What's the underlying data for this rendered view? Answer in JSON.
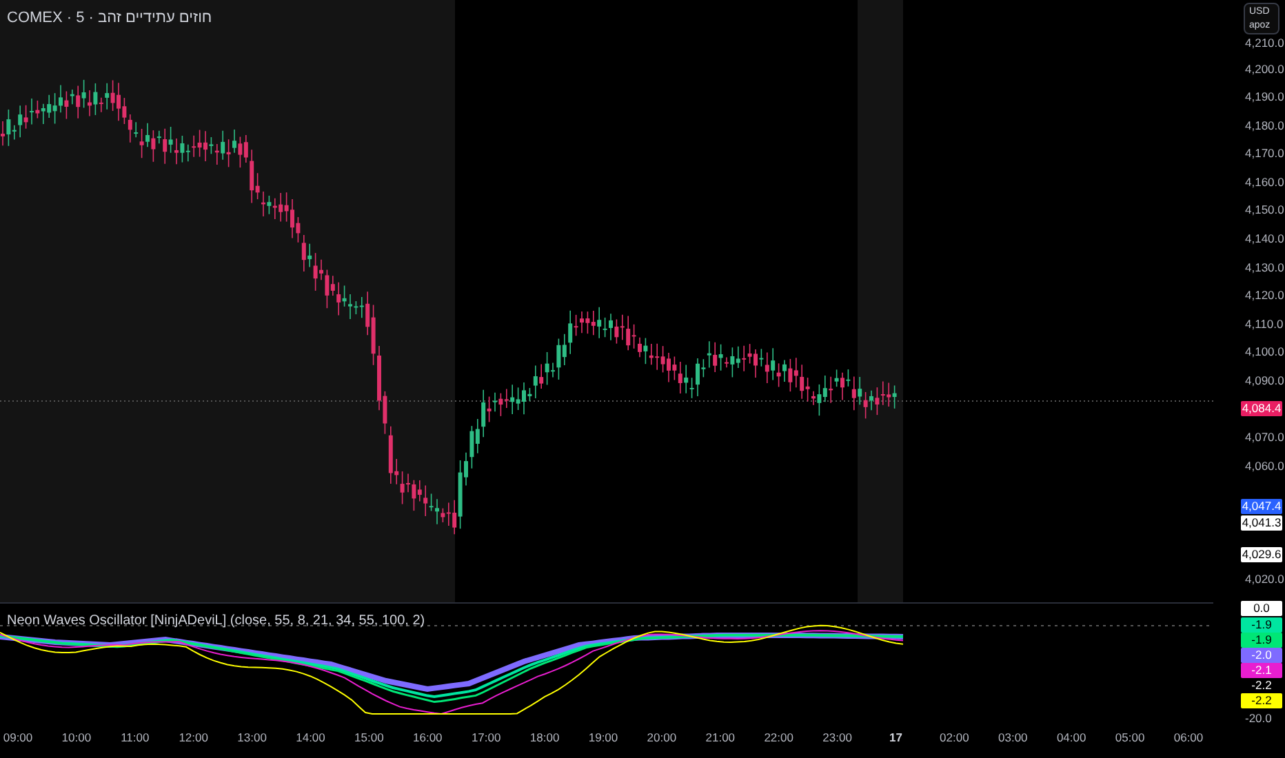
{
  "chart_title": "COMEX · 5 · חוזים עתידיים זהב",
  "currency_box": {
    "currency": "USD",
    "unit": "apoz"
  },
  "price_axis": {
    "ticks": [
      "4,210.0",
      "4,200.0",
      "4,190.0",
      "4,180.0",
      "4,170.0",
      "4,160.0",
      "4,150.0",
      "4,140.0",
      "4,130.0",
      "4,120.0",
      "4,110.0",
      "4,100.0",
      "4,090.0",
      "4,070.0",
      "4,060.0",
      "4,020.0"
    ],
    "badges": [
      {
        "text": "4,084.4",
        "color": "#e91e63"
      },
      {
        "text": "4,047.4",
        "color": "#2962ff"
      },
      {
        "text": "4,041.3",
        "color": "#ffffff"
      },
      {
        "text": "4,029.6",
        "color": "#ffffff"
      }
    ]
  },
  "indicator": {
    "title": "Neon Waves Oscillator [NinjADeviL] (close, 55, 8, 21, 34, 55, 100, 2)",
    "badges": [
      {
        "text": "0.0",
        "color": "#ffffff"
      },
      {
        "text": "-1.9",
        "color": "#00e5a0"
      },
      {
        "text": "-1.9",
        "color": "#00e676"
      },
      {
        "text": "-2.0",
        "color": "#7e6bff"
      },
      {
        "text": "-2.1",
        "color": "#e91ed0"
      },
      {
        "text": "-2.2",
        "color": "#000000"
      },
      {
        "text": "-2.2",
        "color": "#ffff00"
      }
    ],
    "tick": "-20.0"
  },
  "time_axis": [
    {
      "label": "09:00",
      "bold": false
    },
    {
      "label": "10:00",
      "bold": false
    },
    {
      "label": "11:00",
      "bold": false
    },
    {
      "label": "12:00",
      "bold": false
    },
    {
      "label": "13:00",
      "bold": false
    },
    {
      "label": "14:00",
      "bold": false
    },
    {
      "label": "15:00",
      "bold": false
    },
    {
      "label": "16:00",
      "bold": false
    },
    {
      "label": "17:00",
      "bold": false
    },
    {
      "label": "18:00",
      "bold": false
    },
    {
      "label": "19:00",
      "bold": false
    },
    {
      "label": "20:00",
      "bold": false
    },
    {
      "label": "21:00",
      "bold": false
    },
    {
      "label": "22:00",
      "bold": false
    },
    {
      "label": "23:00",
      "bold": false
    },
    {
      "label": "17",
      "bold": true
    },
    {
      "label": "02:00",
      "bold": false
    },
    {
      "label": "03:00",
      "bold": false
    },
    {
      "label": "04:00",
      "bold": false
    },
    {
      "label": "05:00",
      "bold": false
    },
    {
      "label": "06:00",
      "bold": false
    }
  ]
}
